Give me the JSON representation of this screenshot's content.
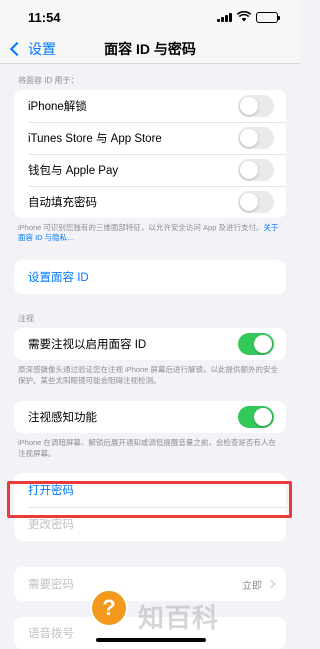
{
  "status_bar": {
    "time": "11:54"
  },
  "nav": {
    "back_label": "设置",
    "title": "面容 ID 与密码"
  },
  "face_id_section": {
    "header": "将面容 ID 用于：",
    "items": [
      {
        "label": "iPhone解锁",
        "on": false
      },
      {
        "label": "iTunes Store 与 App Store",
        "on": false
      },
      {
        "label": "钱包与 Apple Pay",
        "on": false
      },
      {
        "label": "自动填充密码",
        "on": false
      }
    ],
    "footer_text": "iPhone 可识别您独有的三维面部特征，以允许安全访问 App 及进行支付。",
    "footer_link": "关于面容 ID 与隐私…"
  },
  "setup_section": {
    "label": "设置面容 ID"
  },
  "attention_section": {
    "header": "注视",
    "item_label": "需要注视以启用面容 ID",
    "item_on": true,
    "footer": "原深感摄像头通过验证您在注视 iPhone 屏幕后进行解锁，以此提供额外的安全保护。某些太阳眼镜可能会阻碍注视检测。"
  },
  "attention_aware_section": {
    "item_label": "注视感知功能",
    "item_on": true,
    "footer": "iPhone 在调暗屏幕、解锁后展开通知或调低提醒音量之前，会检查是否有人在注视屏幕。"
  },
  "passcode_section": {
    "turn_on_label": "打开密码",
    "change_label": "更改密码"
  },
  "require_section": {
    "label": "需要密码",
    "value": "立即"
  },
  "last_row": {
    "label": "语音拨号"
  },
  "overlay": {
    "help_glyph": "?",
    "watermark": "知百科"
  },
  "colors": {
    "accent": "#007aff",
    "toggle_on": "#34c759",
    "highlight": "#ea3a3a",
    "background": "#f2f2f7"
  },
  "icons": [
    "back-chevron-icon",
    "cellular-signal-icon",
    "wifi-icon",
    "battery-icon",
    "disclosure-chevron-icon"
  ]
}
